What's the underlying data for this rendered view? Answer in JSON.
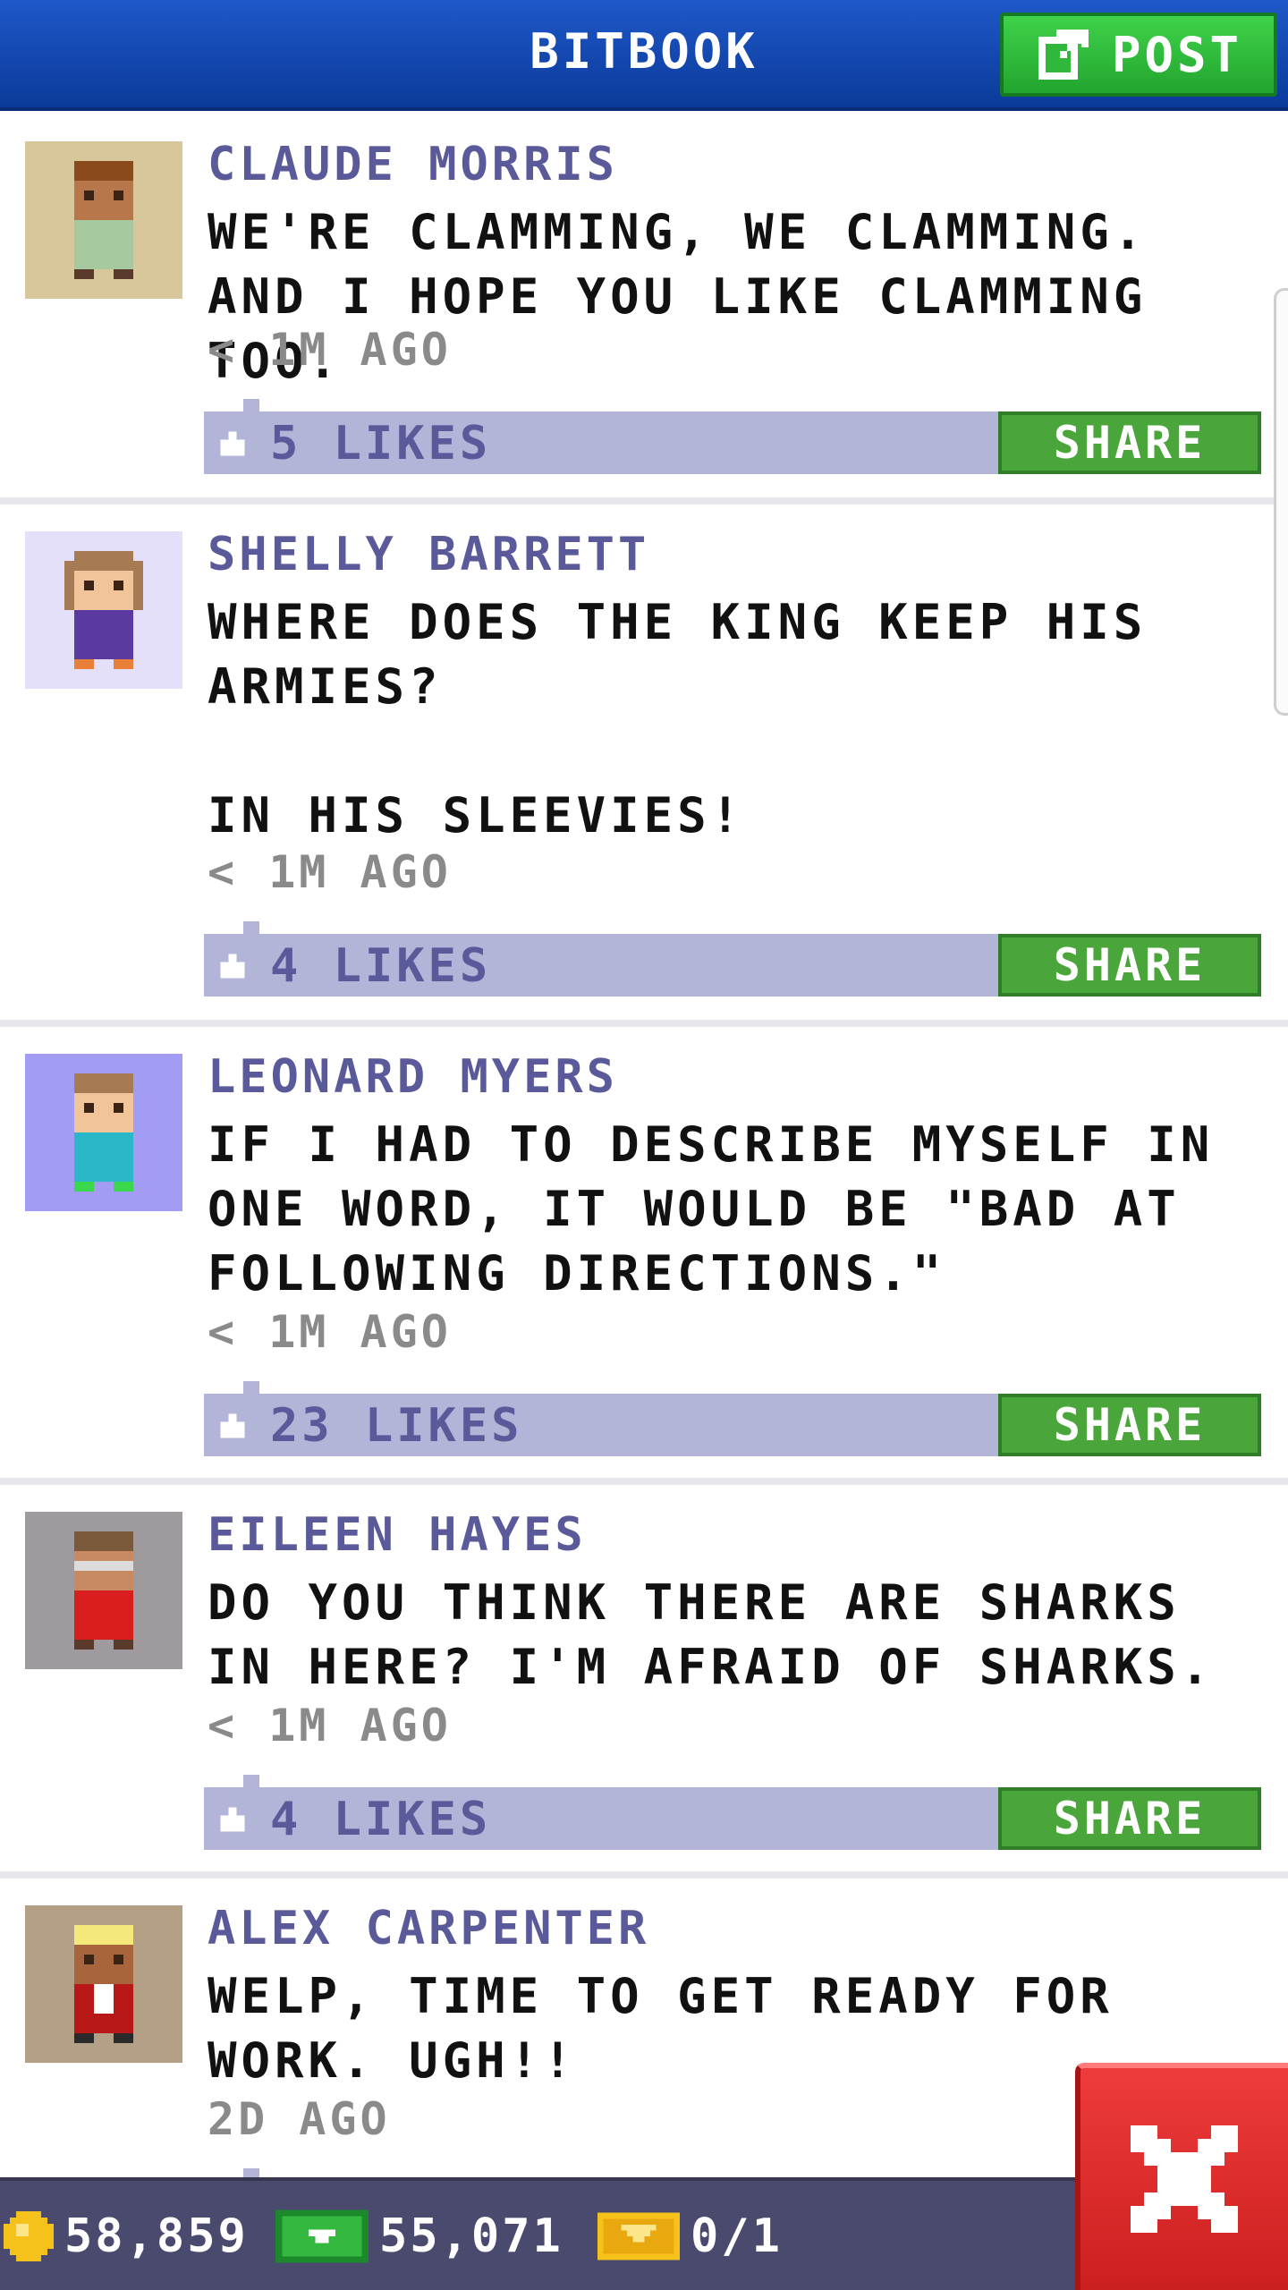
{
  "header": {
    "title": "BITBOOK",
    "post_label": "POST"
  },
  "posts": [
    {
      "author": "CLAUDE MORRIS",
      "message": "WE'RE CLAMMING, WE CLAMMING. AND I HOPE YOU LIKE CLAMMING TOO.",
      "time": "< 1M AGO",
      "likes": "5 LIKES",
      "share": "SHARE"
    },
    {
      "author": "SHELLY BARRETT",
      "message": "WHERE DOES THE KING KEEP HIS ARMIES?\n\nIN HIS SLEEVIES!",
      "time": "< 1M AGO",
      "likes": "4 LIKES",
      "share": "SHARE"
    },
    {
      "author": "LEONARD MYERS",
      "message": "IF I HAD TO DESCRIBE MYSELF IN ONE WORD, IT WOULD BE \"BAD AT FOLLOWING DIRECTIONS.\"",
      "time": "< 1M AGO",
      "likes": "23 LIKES",
      "share": "SHARE"
    },
    {
      "author": "EILEEN HAYES",
      "message": "DO YOU THINK THERE ARE SHARKS IN HERE? I'M AFRAID OF SHARKS.",
      "time": "< 1M AGO",
      "likes": "4 LIKES",
      "share": "SHARE"
    },
    {
      "author": "ALEX CARPENTER",
      "message": "WELP, TIME TO GET READY FOR WORK. UGH!!",
      "time": "2D AGO"
    }
  ],
  "status": {
    "coins": "58,859",
    "bux": "55,071",
    "tickets": "0/1"
  },
  "icons": {
    "post": "edit-icon",
    "like": "thumbs-up-icon",
    "coins": "coin-icon",
    "bux": "cash-icon",
    "tickets": "ticket-icon",
    "close": "close-icon"
  },
  "colors": {
    "header": "#1e58c8",
    "accent_green": "#4aa63b",
    "like_bar": "#b3b5d8",
    "author": "#5a5a9a",
    "close_red": "#ee3b3b",
    "bottom_bar": "#4a4a6e"
  }
}
